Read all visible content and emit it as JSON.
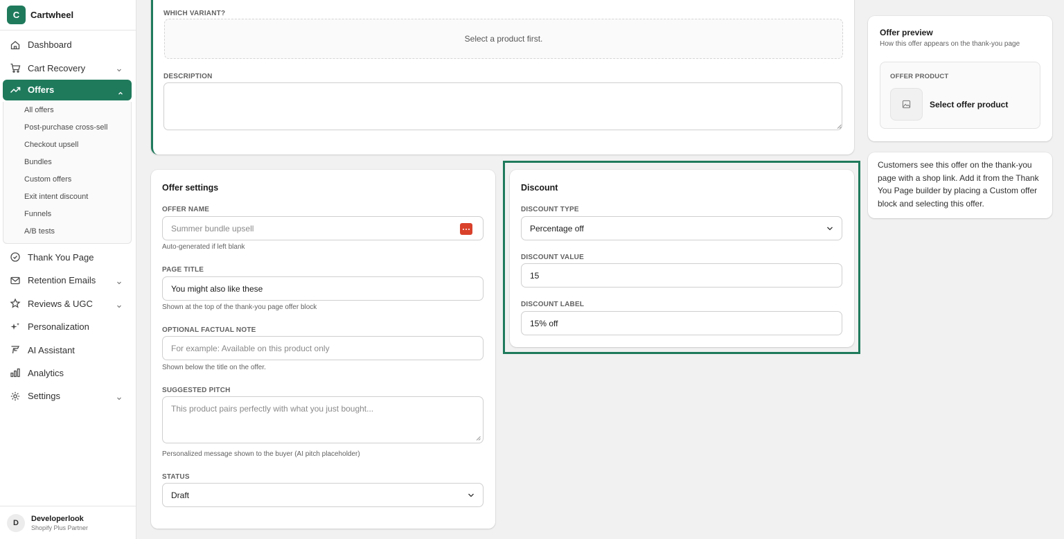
{
  "app": {
    "logo_letter": "C",
    "name": "Cartwheel"
  },
  "nav": {
    "items": [
      {
        "label": "Dashboard",
        "icon": "home-icon"
      },
      {
        "label": "Cart Recovery",
        "icon": "cart-icon",
        "has_chevron": true
      },
      {
        "label": "Offers",
        "icon": "trending-icon",
        "active": true
      }
    ],
    "offers_sub": [
      "All offers",
      "Post-purchase cross-sell",
      "Checkout upsell",
      "Bundles",
      "Custom offers",
      "Exit intent discount",
      "Funnels",
      "A/B tests"
    ],
    "items_after": [
      {
        "label": "Thank You Page",
        "icon": "check-circle-icon"
      },
      {
        "label": "Retention Emails",
        "icon": "mail-icon",
        "has_chevron": true
      },
      {
        "label": "Reviews & UGC",
        "icon": "star-icon",
        "has_chevron": true
      },
      {
        "label": "Personalization",
        "icon": "sparkle-icon"
      },
      {
        "label": "AI Assistant",
        "icon": "ai-icon"
      },
      {
        "label": "Analytics",
        "icon": "bar-chart-icon"
      },
      {
        "label": "Settings",
        "icon": "gear-icon",
        "has_chevron": true
      }
    ]
  },
  "user": {
    "initial": "D",
    "name": "Developerlook",
    "role": "Shopify Plus Partner"
  },
  "top_card": {
    "variant_label": "WHICH VARIANT?",
    "variant_placeholder": "Select a product first.",
    "description_label": "DESCRIPTION",
    "description_value": ""
  },
  "offer_settings": {
    "title": "Offer settings",
    "offer_name_label": "OFFER NAME",
    "offer_name_placeholder": "Summer bundle upsell",
    "offer_name_help": "Auto-generated if left blank",
    "page_title_label": "PAGE TITLE",
    "page_title_value": "You might also like these",
    "page_title_help": "Shown at the top of the thank-you page offer block",
    "note_label": "OPTIONAL FACTUAL NOTE",
    "note_placeholder": "For example: Available on this product only",
    "note_help": "Shown below the title on the offer.",
    "pitch_label": "SUGGESTED PITCH",
    "pitch_placeholder": "This product pairs perfectly with what you just bought...",
    "pitch_help": "Personalized message shown to the buyer (AI pitch placeholder)",
    "status_label": "STATUS",
    "status_value": "Draft"
  },
  "discount": {
    "title": "Discount",
    "type_label": "DISCOUNT TYPE",
    "type_value": "Percentage off",
    "value_label": "DISCOUNT VALUE",
    "value": "15",
    "label_label": "DISCOUNT LABEL",
    "label_value": "15% off"
  },
  "preview": {
    "title": "Offer preview",
    "subtitle": "How this offer appears on the thank-you page",
    "product_label": "OFFER PRODUCT",
    "product_text": "Select offer product"
  },
  "info": {
    "text": "Customers see this offer on the thank-you page with a shop link. Add it from the Thank You Page builder by placing a Custom offer block and selecting this offer."
  },
  "colors": {
    "accent": "#1f7a5c",
    "ai_button": "#d9412b"
  }
}
